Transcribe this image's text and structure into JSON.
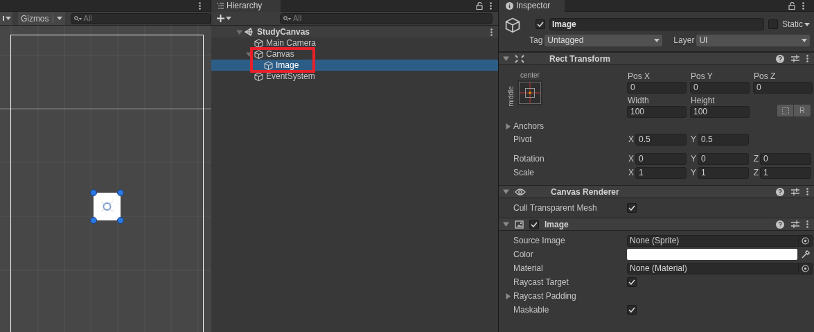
{
  "scene_view": {
    "gizmos_button": "Gizmos",
    "search": {
      "placeholder": "All"
    }
  },
  "hierarchy": {
    "tab": "Hierarchy",
    "search": {
      "placeholder": "All"
    },
    "items": [
      {
        "kind": "scene",
        "name": "StudyCanvas",
        "expanded": true,
        "selected": false,
        "children": [
          {
            "kind": "object",
            "name": "Main Camera",
            "selected": false
          },
          {
            "kind": "object",
            "name": "Canvas",
            "expanded": true,
            "selected": false,
            "children": [
              {
                "kind": "object",
                "name": "Image",
                "selected": true
              }
            ]
          },
          {
            "kind": "object",
            "name": "EventSystem",
            "selected": false
          }
        ]
      }
    ]
  },
  "inspector": {
    "tab": "Inspector",
    "object": {
      "active": true,
      "name": "Image",
      "static": false,
      "static_label": "Static",
      "tag_label": "Tag",
      "tag": "Untagged",
      "layer_label": "Layer",
      "layer": "UI"
    },
    "components": [
      {
        "kind": "rect_transform",
        "title": "Rect Transform",
        "expanded": true,
        "anchor_horizontal": "center",
        "anchor_vertical": "middle",
        "position_fields": [
          {
            "label": "Pos X",
            "value": "0"
          },
          {
            "label": "Pos Y",
            "value": "0"
          },
          {
            "label": "Pos Z",
            "value": "0"
          }
        ],
        "size_fields": [
          {
            "label": "Width",
            "value": "100"
          },
          {
            "label": "Height",
            "value": "100"
          }
        ],
        "raw_edit_button": "R",
        "anchors": {
          "label": "Anchors",
          "expanded": false
        },
        "vectors": [
          {
            "label": "Pivot",
            "fields": [
              {
                "axis": "X",
                "value": "0.5"
              },
              {
                "axis": "Y",
                "value": "0.5"
              }
            ]
          },
          {
            "label": "Rotation",
            "fields": [
              {
                "axis": "X",
                "value": "0"
              },
              {
                "axis": "Y",
                "value": "0"
              },
              {
                "axis": "Z",
                "value": "0"
              }
            ]
          },
          {
            "label": "Scale",
            "fields": [
              {
                "axis": "X",
                "value": "1"
              },
              {
                "axis": "Y",
                "value": "1"
              },
              {
                "axis": "Z",
                "value": "1"
              }
            ]
          }
        ]
      },
      {
        "kind": "canvas_renderer",
        "title": "Canvas Renderer",
        "expanded": true,
        "properties": [
          {
            "kind": "checkbox",
            "label": "Cull Transparent Mesh",
            "checked": true
          }
        ]
      },
      {
        "kind": "image",
        "title": "Image",
        "expanded": true,
        "enabled": true,
        "properties": [
          {
            "kind": "object",
            "label": "Source Image",
            "value": "None (Sprite)"
          },
          {
            "kind": "color",
            "label": "Color",
            "color": "#ffffff"
          },
          {
            "kind": "object",
            "label": "Material",
            "value": "None (Material)"
          },
          {
            "kind": "checkbox",
            "label": "Raycast Target",
            "checked": true
          },
          {
            "kind": "foldout",
            "label": "Raycast Padding",
            "expanded": false
          },
          {
            "kind": "checkbox",
            "label": "Maskable",
            "checked": true
          }
        ]
      }
    ]
  }
}
